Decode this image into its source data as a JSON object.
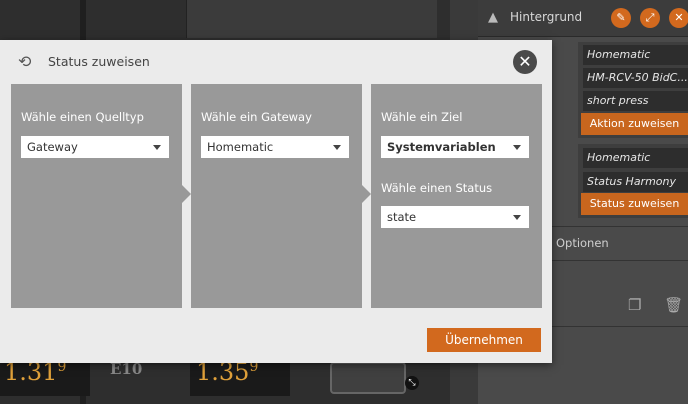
{
  "right_panel": {
    "header_title": "Hintergrund",
    "header_icon": "landscape-icon",
    "group1": {
      "fields": [
        "Homematic",
        "HM-RCV-50 BidC...",
        "short press"
      ],
      "button": "Aktion zuweisen"
    },
    "group2": {
      "fields": [
        "Homematic",
        "Status Harmony"
      ],
      "button": "Status zuweisen"
    },
    "options_label": "rte Optionen"
  },
  "background": {
    "lcd1": "1.31",
    "lcd1_sup": "9",
    "lcd2": "1.35",
    "lcd2_sup": "9",
    "e10": "E10"
  },
  "modal": {
    "title": "Status zuweisen",
    "title_icon": "refresh-icon",
    "columns": [
      {
        "label": "Wähle einen Quelltyp",
        "value": "Gateway"
      },
      {
        "label": "Wähle ein Gateway",
        "value": "Homematic"
      },
      {
        "label": "Wähle ein Ziel",
        "value": "Systemvariablen",
        "label2": "Wähle einen Status",
        "value2": "state"
      }
    ],
    "apply_label": "Übernehmen"
  },
  "colors": {
    "accent": "#d2691e",
    "modal_bg": "#ebebeb",
    "column_bg": "#999999"
  }
}
